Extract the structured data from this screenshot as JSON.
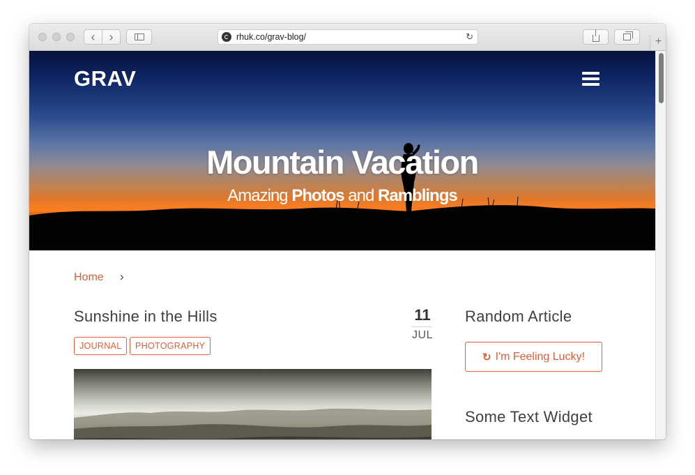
{
  "browser": {
    "url": "rhuk.co/grav-blog/",
    "back_glyph": "‹",
    "forward_glyph": "›",
    "reload_glyph": "↻",
    "new_tab_glyph": "+"
  },
  "site": {
    "brand": "GRAV",
    "menu_icon": "hamburger-menu-icon"
  },
  "hero": {
    "title": "Mountain Vacation",
    "subtitle_parts": [
      "Amazing ",
      "Photos",
      " and ",
      "Ramblings"
    ]
  },
  "breadcrumb": {
    "home": "Home",
    "separator": "›"
  },
  "post": {
    "title": "Sunshine in the Hills",
    "date_day": "11",
    "date_month": "JUL",
    "tags": [
      "JOURNAL",
      "PHOTOGRAPHY"
    ]
  },
  "sidebar": {
    "random_title": "Random Article",
    "lucky_icon": "↻",
    "lucky_label": "I'm Feeling Lucky!",
    "text_widget_title": "Some Text Widget"
  },
  "colors": {
    "accent": "#d9603b",
    "heading": "#404040"
  }
}
